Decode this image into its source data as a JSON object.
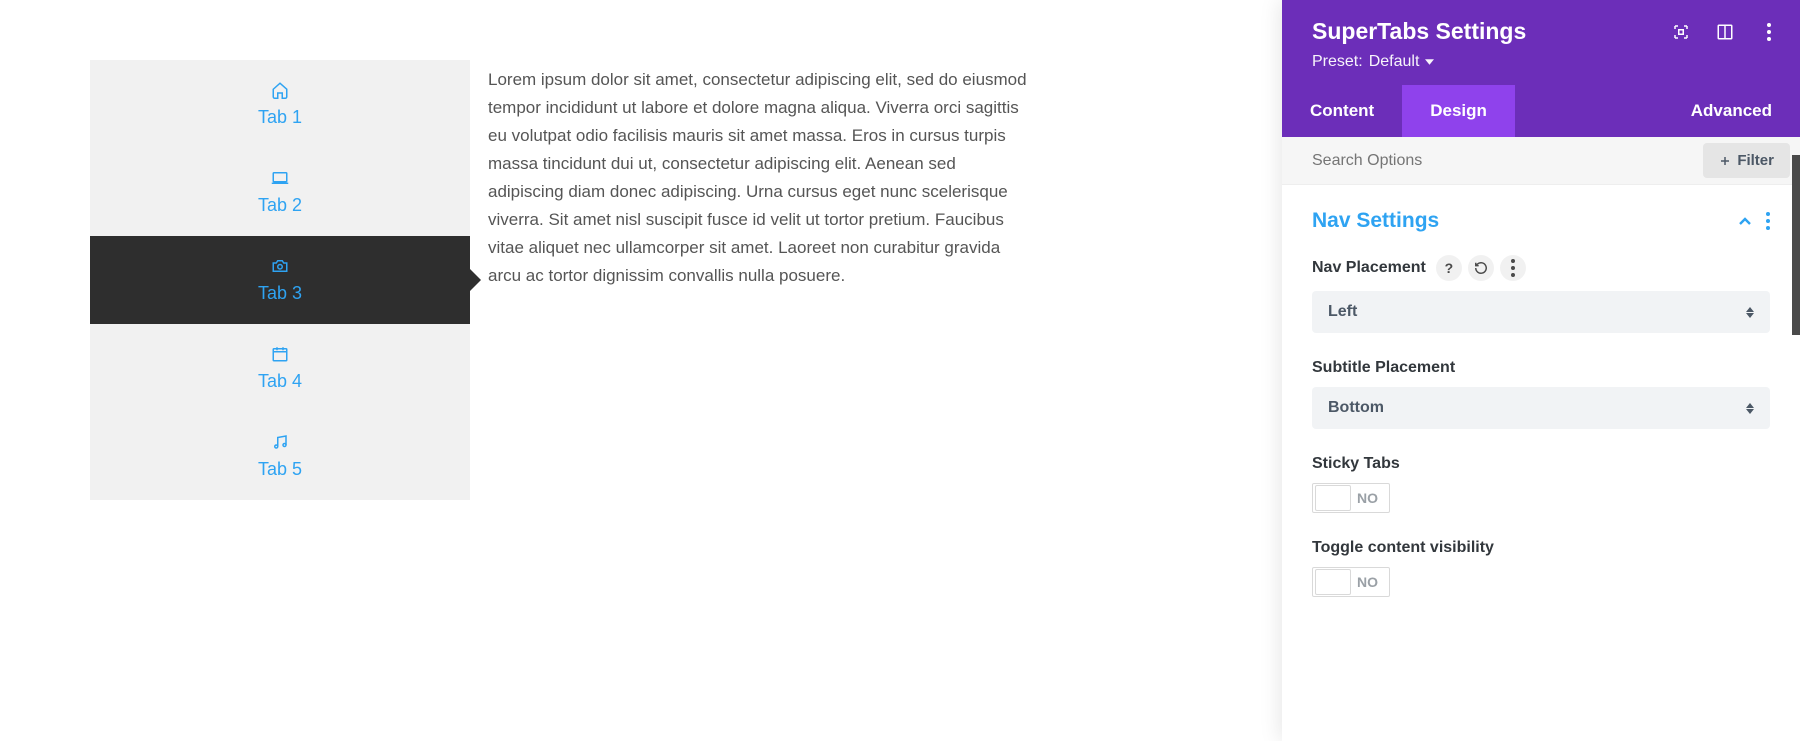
{
  "tabs": [
    {
      "label": "Tab 1",
      "icon": "home"
    },
    {
      "label": "Tab 2",
      "icon": "laptop"
    },
    {
      "label": "Tab 3",
      "icon": "camera"
    },
    {
      "label": "Tab 4",
      "icon": "calendar"
    },
    {
      "label": "Tab 5",
      "icon": "music"
    }
  ],
  "content": "Lorem ipsum dolor sit amet, consectetur adipiscing elit, sed do eiusmod tempor incididunt ut labore et dolore magna aliqua. Viverra orci sagittis eu volutpat odio facilisis mauris sit amet massa. Eros in cursus turpis massa tincidunt dui ut, consectetur adipiscing elit. Aenean sed adipiscing diam donec adipiscing. Urna cursus eget nunc scelerisque viverra. Sit amet nisl suscipit fusce id velit ut tortor pretium. Faucibus vitae aliquet nec ullamcorper sit amet. Laoreet non curabitur gravida arcu ac tortor dignissim convallis nulla posuere.",
  "panel": {
    "title": "SuperTabs Settings",
    "preset_prefix": "Preset:",
    "preset_value": "Default",
    "tabs": [
      "Content",
      "Design",
      "Advanced"
    ],
    "active_tab": 1,
    "search_placeholder": "Search Options",
    "filter_label": "Filter",
    "section": {
      "title": "Nav Settings",
      "fields": {
        "nav_placement": {
          "label": "Nav Placement",
          "value": "Left"
        },
        "subtitle_placement": {
          "label": "Subtitle Placement",
          "value": "Bottom"
        },
        "sticky_tabs": {
          "label": "Sticky Tabs",
          "value": "NO"
        },
        "toggle_visibility": {
          "label": "Toggle content visibility",
          "value": "NO"
        }
      }
    }
  },
  "colors": {
    "purple_dark": "#6c2eb9",
    "purple_light": "#8f42ec",
    "blue": "#2ea3f2"
  }
}
